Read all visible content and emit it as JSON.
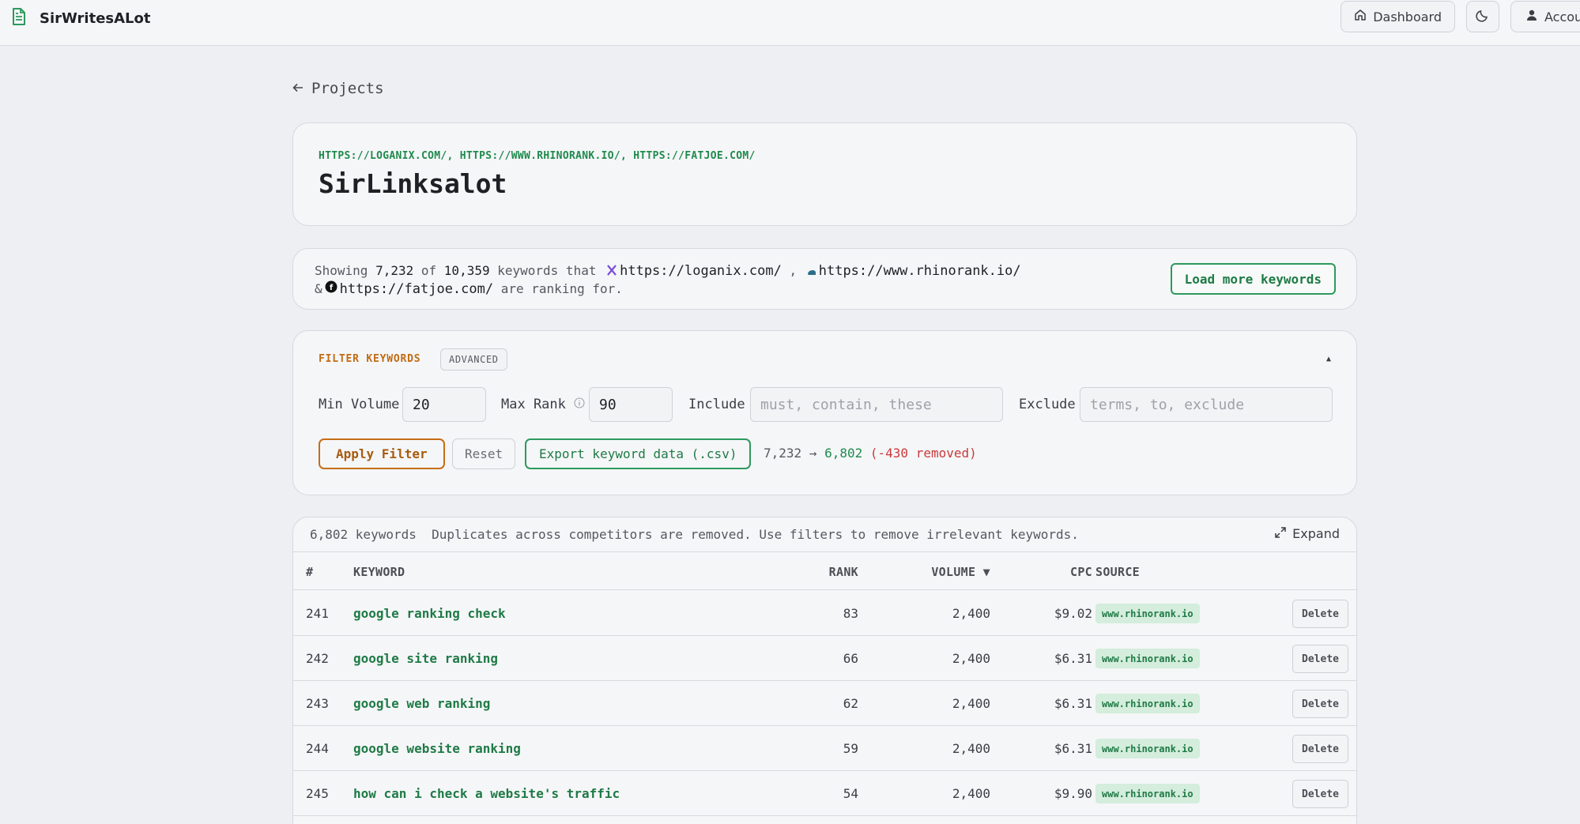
{
  "app": {
    "name": "SirWritesALot"
  },
  "topnav": {
    "dashboard": "Dashboard",
    "account": "Account"
  },
  "back": {
    "label": "Projects"
  },
  "project": {
    "urls": "HTTPS://LOGANIX.COM/, HTTPS://WWW.RHINORANK.IO/, HTTPS://FATJOE.COM/",
    "name": "SirLinksalot"
  },
  "summary": {
    "showing": "Showing",
    "shown": "7,232",
    "of": "of",
    "total": "10,359",
    "mid": "keywords that",
    "site1": "https://loganix.com/",
    "comma": ",",
    "site2": "https://www.rhinorank.io/",
    "amp": "&",
    "site3": "https://fatjoe.com/",
    "tail": "are ranking for.",
    "load_more": "Load more keywords"
  },
  "filter": {
    "title": "FILTER KEYWORDS",
    "badge": "ADVANCED",
    "collapse": "▲",
    "min_volume_label": "Min Volume",
    "min_volume_value": "20",
    "max_rank_label": "Max Rank",
    "max_rank_value": "90",
    "include_label": "Include",
    "include_placeholder": "must, contain, these",
    "exclude_label": "Exclude",
    "exclude_placeholder": "terms, to, exclude",
    "apply": "Apply Filter",
    "reset": "Reset",
    "export": "Export keyword data (.csv)",
    "delta_from": "7,232 →",
    "delta_to": "6,802",
    "delta_removed": "(-430 removed)"
  },
  "table": {
    "count": "6,802 keywords",
    "note": "Duplicates across competitors are removed. Use filters to remove irrelevant keywords.",
    "expand": "Expand",
    "columns": {
      "num": "#",
      "keyword": "KEYWORD",
      "rank": "RANK",
      "volume": "VOLUME ▼",
      "cpc": "CPC",
      "source": "SOURCE"
    },
    "delete_label": "Delete",
    "rows": [
      {
        "num": "241",
        "keyword": "google ranking check",
        "rank": "83",
        "volume": "2,400",
        "cpc": "$9.02",
        "source": "www.rhinorank.io"
      },
      {
        "num": "242",
        "keyword": "google site ranking",
        "rank": "66",
        "volume": "2,400",
        "cpc": "$6.31",
        "source": "www.rhinorank.io"
      },
      {
        "num": "243",
        "keyword": "google web ranking",
        "rank": "62",
        "volume": "2,400",
        "cpc": "$6.31",
        "source": "www.rhinorank.io"
      },
      {
        "num": "244",
        "keyword": "google website ranking",
        "rank": "59",
        "volume": "2,400",
        "cpc": "$6.31",
        "source": "www.rhinorank.io"
      },
      {
        "num": "245",
        "keyword": "how can i check a website's traffic",
        "rank": "54",
        "volume": "2,400",
        "cpc": "$9.90",
        "source": "www.rhinorank.io"
      }
    ]
  },
  "colors": {
    "accent_green": "#1f8a4d",
    "accent_orange": "#c26b13",
    "removed_red": "#c93a3a"
  }
}
